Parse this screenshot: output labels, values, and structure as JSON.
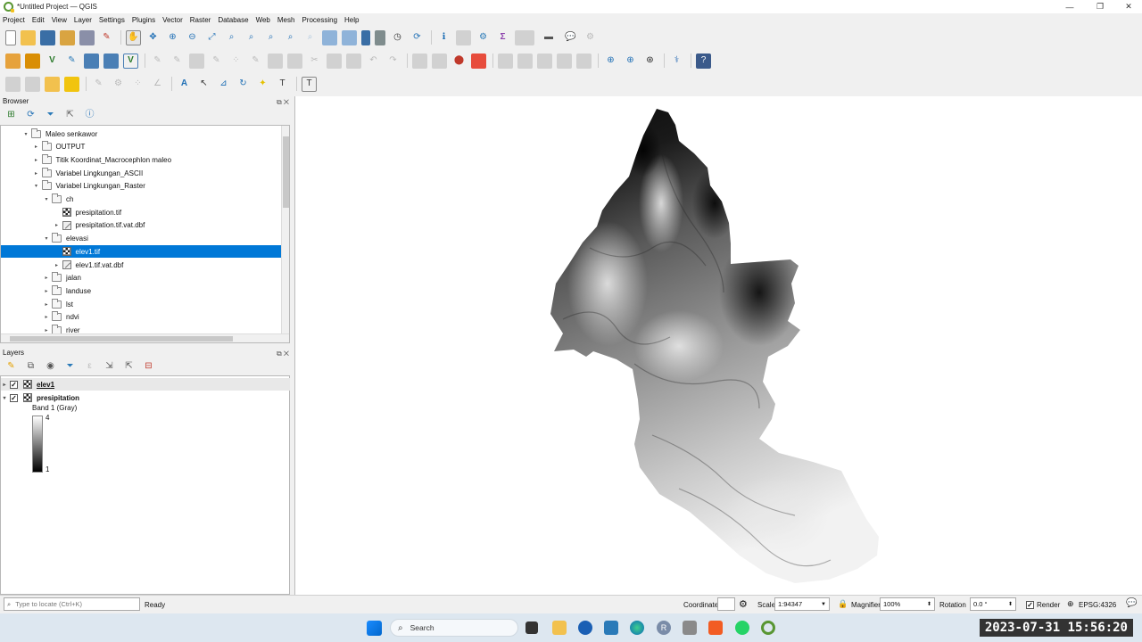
{
  "window": {
    "title": "*Untitled Project — QGIS"
  },
  "menu": [
    "Project",
    "Edit",
    "View",
    "Layer",
    "Settings",
    "Plugins",
    "Vector",
    "Raster",
    "Database",
    "Web",
    "Mesh",
    "Processing",
    "Help"
  ],
  "browser": {
    "title": "Browser",
    "items": [
      {
        "label": "Maleo senkawor",
        "level": 0,
        "icon": "folder-icon",
        "expanded": true
      },
      {
        "label": "OUTPUT",
        "level": 1,
        "icon": "folder-icon",
        "expanded": false
      },
      {
        "label": "Titik Koordinat_Macrocephlon maleo",
        "level": 1,
        "icon": "folder-icon",
        "expanded": false
      },
      {
        "label": "Variabel Lingkungan_ASCII",
        "level": 1,
        "icon": "folder-icon",
        "expanded": false
      },
      {
        "label": "Variabel Lingkungan_Raster",
        "level": 1,
        "icon": "folder-icon",
        "expanded": true
      },
      {
        "label": "ch",
        "level": 2,
        "icon": "folder-icon",
        "expanded": true
      },
      {
        "label": "presipitation.tif",
        "level": 3,
        "icon": "raster-icon",
        "expanded": null
      },
      {
        "label": "presipitation.tif.vat.dbf",
        "level": 3,
        "icon": "table-icon",
        "expanded": false
      },
      {
        "label": "elevasi",
        "level": 2,
        "icon": "folder-icon",
        "expanded": true
      },
      {
        "label": "elev1.tif",
        "level": 3,
        "icon": "raster-icon",
        "expanded": null,
        "selected": true
      },
      {
        "label": "elev1.tif.vat.dbf",
        "level": 3,
        "icon": "table-icon",
        "expanded": false
      },
      {
        "label": "jalan",
        "level": 2,
        "icon": "folder-icon",
        "expanded": false
      },
      {
        "label": "landuse",
        "level": 2,
        "icon": "folder-icon",
        "expanded": false
      },
      {
        "label": "lst",
        "level": 2,
        "icon": "folder-icon",
        "expanded": false
      },
      {
        "label": "ndvi",
        "level": 2,
        "icon": "folder-icon",
        "expanded": false
      },
      {
        "label": "river",
        "level": 2,
        "icon": "folder-icon",
        "expanded": false
      }
    ]
  },
  "layers": {
    "title": "Layers",
    "items": [
      {
        "name": "elev1",
        "checked": true,
        "underline": true
      },
      {
        "name": "presipitation",
        "checked": true,
        "underline": false
      }
    ],
    "legend": {
      "band": "Band 1 (Gray)",
      "max": "4",
      "min": "1"
    }
  },
  "status": {
    "locator_placeholder": "Type to locate (Ctrl+K)",
    "message": "Ready",
    "coordinate_label": "Coordinate",
    "scale_label": "Scale",
    "scale_value": "1:94347",
    "magnifier_label": "Magnifier",
    "magnifier_value": "100%",
    "rotation_label": "Rotation",
    "rotation_value": "0.0 °",
    "render_label": "Render",
    "crs": "EPSG:4326"
  },
  "taskbar": {
    "search_label": "Search",
    "clock": "2023-07-31  15:56:20"
  },
  "colors": {
    "selection": "#0078d7",
    "qgis_green": "#589632",
    "taskbar_bg": "#dde7f0"
  }
}
